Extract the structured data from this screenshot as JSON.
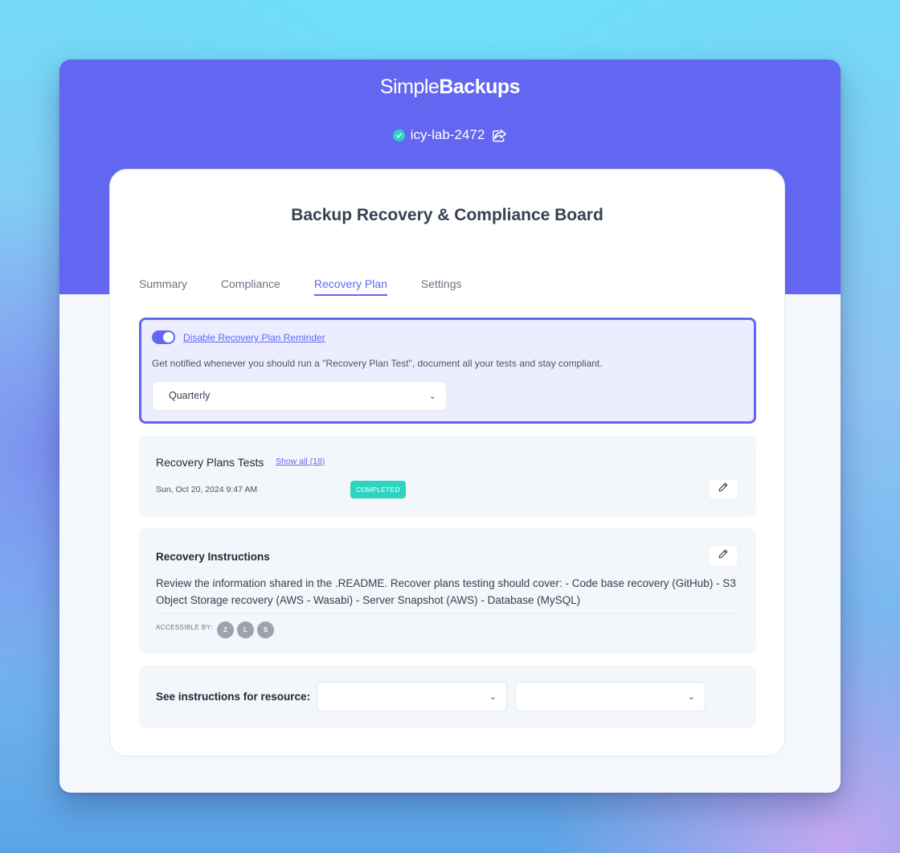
{
  "app": {
    "logo_light": "Simple",
    "logo_bold": "Backups",
    "project_name": "icy-lab-2472"
  },
  "board": {
    "title": "Backup Recovery & Compliance Board",
    "tabs": [
      {
        "label": "Summary",
        "active": false
      },
      {
        "label": "Compliance",
        "active": false
      },
      {
        "label": "Recovery Plan",
        "active": true
      },
      {
        "label": "Settings",
        "active": false
      }
    ]
  },
  "reminder": {
    "toggle_on": true,
    "link_label": "Disable Recovery Plan Reminder",
    "description": "Get notified whenever you should run a \"Recovery Plan Test\", document all your tests and stay compliant.",
    "frequency": "Quarterly"
  },
  "tests": {
    "title": "Recovery Plans Tests",
    "show_all": "Show all (18)",
    "latest": {
      "date": "Sun, Oct 20, 2024 9:47 AM",
      "status": "COMPLETED"
    }
  },
  "instructions": {
    "title": "Recovery Instructions",
    "text": "Review the information shared in the .README. Recover plans testing should cover: - Code base recovery (GitHub) - S3 Object Storage recovery (AWS - Wasabi) - Server Snapshot (AWS) - Database (MySQL)",
    "accessible_label": "ACCESSIBLE BY:",
    "accessible_by": [
      "Z",
      "L",
      "S"
    ]
  },
  "resource": {
    "label": "See instructions for resource:",
    "select_1": "",
    "select_2": ""
  },
  "colors": {
    "accent": "#6366f1",
    "success": "#2dd4bf",
    "avatar": "#9ca3af"
  }
}
